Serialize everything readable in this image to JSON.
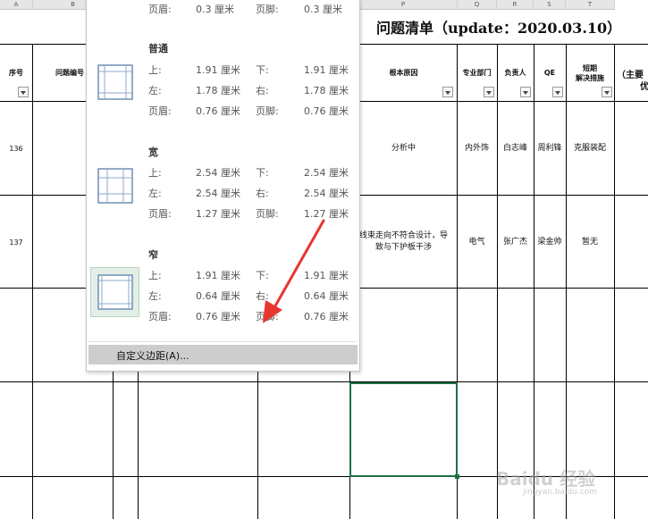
{
  "sheet": {
    "title": "问题清单（update：2020.03.10）",
    "col_letters": {
      "a": "A",
      "b": "B",
      "p": "P",
      "q": "Q",
      "r": "R",
      "s": "S",
      "t": "T"
    },
    "headers": {
      "seq": "序号",
      "issue_no": "问题编号",
      "root_cause": "根本原因",
      "dept": "专业部门",
      "owner": "负责人",
      "qe": "QE",
      "short_term_line1": "短期",
      "short_term_line2": "解决措施",
      "main_line1": "（主要",
      "main_line2": "优"
    },
    "rows": [
      {
        "seq": "136",
        "root_cause": "分析中",
        "dept": "内外饰",
        "owner": "白志峰",
        "qe": "周利锋",
        "short_term": "克服装配"
      },
      {
        "seq": "137",
        "root_cause_line1": "线束走向不符合设计，导",
        "root_cause_line2": "致与下护板干涉",
        "dept": "电气",
        "owner": "张广杰",
        "qe": "梁金帅",
        "short_term": "暂无"
      }
    ]
  },
  "menu": {
    "top_row": {
      "header_label": "页眉:",
      "header_val": "0.3 厘米",
      "footer_label": "页脚:",
      "footer_val": "0.3 厘米"
    },
    "options": [
      {
        "name": "普通",
        "top_label": "上:",
        "top": "1.91 厘米",
        "bottom_label": "下:",
        "bottom": "1.91 厘米",
        "left_label": "左:",
        "left": "1.78 厘米",
        "right_label": "右:",
        "right": "1.78 厘米",
        "header_label": "页眉:",
        "header": "0.76 厘米",
        "footer_label": "页脚:",
        "footer": "0.76 厘米",
        "selected": false
      },
      {
        "name": "宽",
        "top_label": "上:",
        "top": "2.54 厘米",
        "bottom_label": "下:",
        "bottom": "2.54 厘米",
        "left_label": "左:",
        "left": "2.54 厘米",
        "right_label": "右:",
        "right": "2.54 厘米",
        "header_label": "页眉:",
        "header": "1.27 厘米",
        "footer_label": "页脚:",
        "footer": "1.27 厘米",
        "selected": false
      },
      {
        "name": "窄",
        "top_label": "上:",
        "top": "1.91 厘米",
        "bottom_label": "下:",
        "bottom": "1.91 厘米",
        "left_label": "左:",
        "left": "0.64 厘米",
        "right_label": "右:",
        "right": "0.64 厘米",
        "header_label": "页眉:",
        "header": "0.76 厘米",
        "footer_label": "页脚:",
        "footer": "0.76 厘米",
        "selected": true
      }
    ],
    "custom_label": "自定义边距(A)..."
  },
  "watermark": {
    "brand": "Baidu 经验",
    "url": "jingyan.baidu.com"
  },
  "colors": {
    "selection": "#1e7145",
    "annotation_arrow": "#e8362f",
    "selected_option_bg": "#e3efe6"
  }
}
